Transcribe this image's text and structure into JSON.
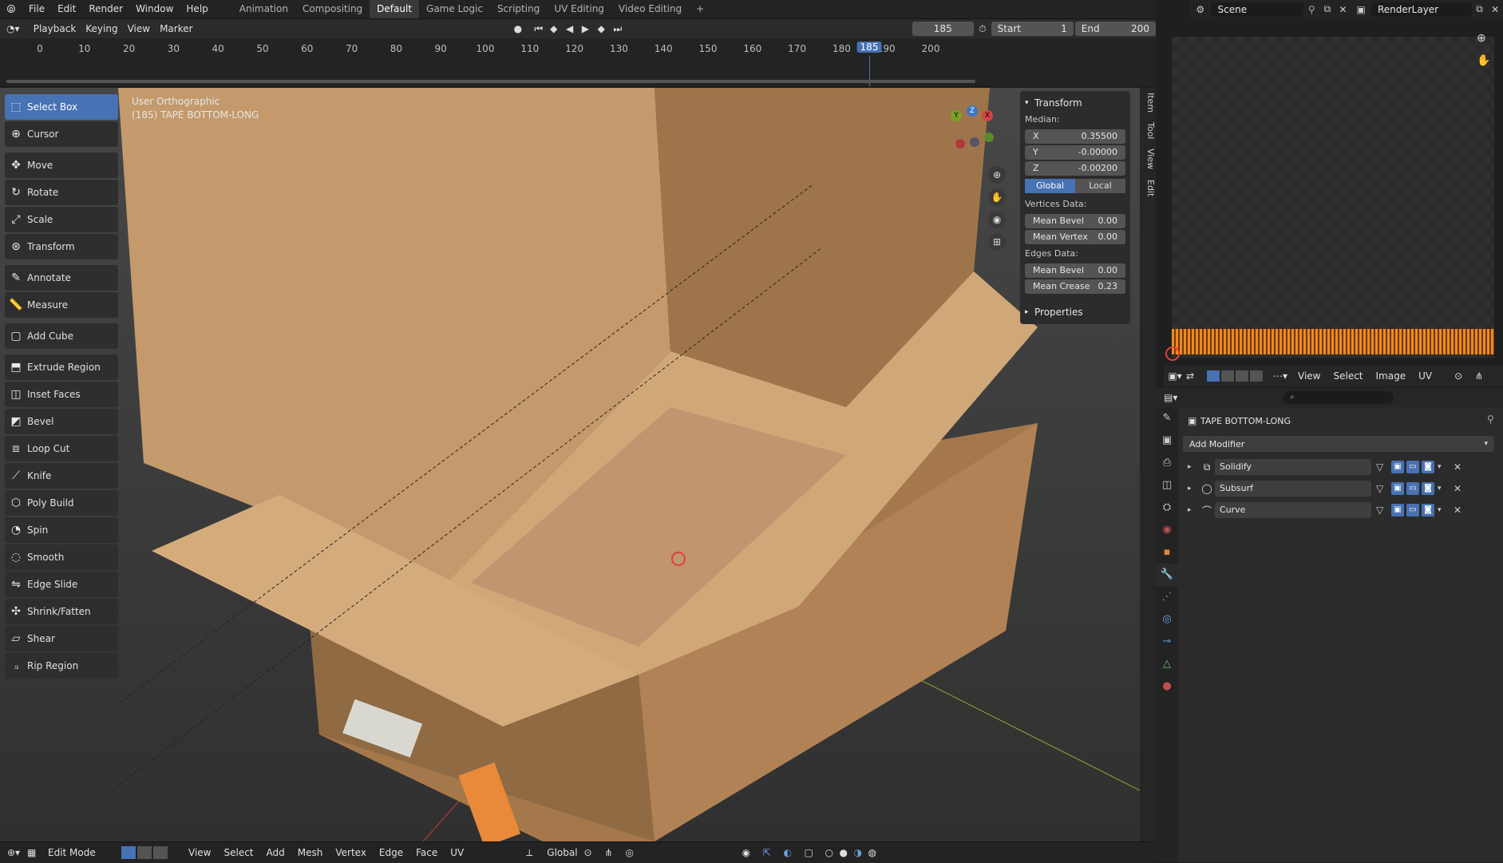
{
  "menu": {
    "items": [
      "File",
      "Edit",
      "Render",
      "Window",
      "Help"
    ],
    "workspaces": [
      "Animation",
      "Compositing",
      "Default",
      "Game Logic",
      "Scripting",
      "UV Editing",
      "Video Editing"
    ],
    "active_workspace": "Default",
    "add_workspace": "+"
  },
  "scene": {
    "scene_name": "Scene",
    "render_layer": "RenderLayer"
  },
  "timeline": {
    "playback": "Playback",
    "keying": "Keying",
    "view": "View",
    "marker": "Marker",
    "current_frame": "185",
    "start_label": "Start",
    "start": "1",
    "end_label": "End",
    "end": "200",
    "ticks": [
      "0",
      "10",
      "20",
      "30",
      "40",
      "50",
      "60",
      "70",
      "80",
      "90",
      "100",
      "110",
      "120",
      "130",
      "140",
      "150",
      "160",
      "170",
      "180",
      "190",
      "200"
    ],
    "marker_frame": "185"
  },
  "viewport": {
    "view_name": "User Orthographic",
    "object_label": "(185) TAPE BOTTOM-LONG"
  },
  "tools": [
    {
      "label": "Select Box",
      "icon": "select-box-icon",
      "active": true
    },
    {
      "label": "Cursor",
      "icon": "cursor-icon"
    },
    {
      "label": "Move",
      "icon": "move-icon"
    },
    {
      "label": "Rotate",
      "icon": "rotate-icon"
    },
    {
      "label": "Scale",
      "icon": "scale-icon"
    },
    {
      "label": "Transform",
      "icon": "transform-icon"
    },
    {
      "label": "Annotate",
      "icon": "annotate-icon"
    },
    {
      "label": "Measure",
      "icon": "measure-icon"
    },
    {
      "label": "Add Cube",
      "icon": "add-cube-icon"
    },
    {
      "label": "Extrude Region",
      "icon": "extrude-icon"
    },
    {
      "label": "Inset Faces",
      "icon": "inset-icon"
    },
    {
      "label": "Bevel",
      "icon": "bevel-icon"
    },
    {
      "label": "Loop Cut",
      "icon": "loop-cut-icon"
    },
    {
      "label": "Knife",
      "icon": "knife-icon"
    },
    {
      "label": "Poly Build",
      "icon": "poly-build-icon"
    },
    {
      "label": "Spin",
      "icon": "spin-icon"
    },
    {
      "label": "Smooth",
      "icon": "smooth-icon"
    },
    {
      "label": "Edge Slide",
      "icon": "edge-slide-icon"
    },
    {
      "label": "Shrink/Fatten",
      "icon": "shrink-fatten-icon"
    },
    {
      "label": "Shear",
      "icon": "shear-icon"
    },
    {
      "label": "Rip Region",
      "icon": "rip-region-icon"
    }
  ],
  "npanel": {
    "transform_title": "Transform",
    "median_label": "Median:",
    "x_label": "X",
    "x": "0.35500",
    "y_label": "Y",
    "y": "-0.00000",
    "z_label": "Z",
    "z": "-0.00200",
    "global": "Global",
    "local": "Local",
    "vertices_label": "Vertices Data:",
    "v_mean_bevel_label": "Mean Bevel",
    "v_mean_bevel": "0.00",
    "v_mean_vertex_label": "Mean Vertex",
    "v_mean_vertex": "0.00",
    "edges_label": "Edges Data:",
    "e_mean_bevel_label": "Mean Bevel",
    "e_mean_bevel": "0.00",
    "e_mean_crease_label": "Mean Crease",
    "e_mean_crease": "0.23",
    "properties_title": "Properties",
    "side_tabs": [
      "Item",
      "Tool",
      "View",
      "Edit"
    ]
  },
  "bottombar": {
    "mode": "Edit Mode",
    "items": [
      "View",
      "Select",
      "Add",
      "Mesh",
      "Vertex",
      "Edge",
      "Face",
      "UV"
    ],
    "orientation": "Global"
  },
  "uv_header": {
    "items": [
      "View",
      "Select",
      "Image",
      "UV"
    ]
  },
  "properties": {
    "object_name": "TAPE BOTTOM-LONG",
    "add_modifier": "Add Modifier",
    "modifiers": [
      {
        "name": "Solidify",
        "icon": "solidify-icon"
      },
      {
        "name": "Subsurf",
        "icon": "subsurf-icon"
      },
      {
        "name": "Curve",
        "icon": "curve-icon"
      }
    ]
  },
  "colors": {
    "accent": "#4772b3",
    "cardboard": "#c49a6c",
    "uv_orange": "#f08a1c"
  }
}
